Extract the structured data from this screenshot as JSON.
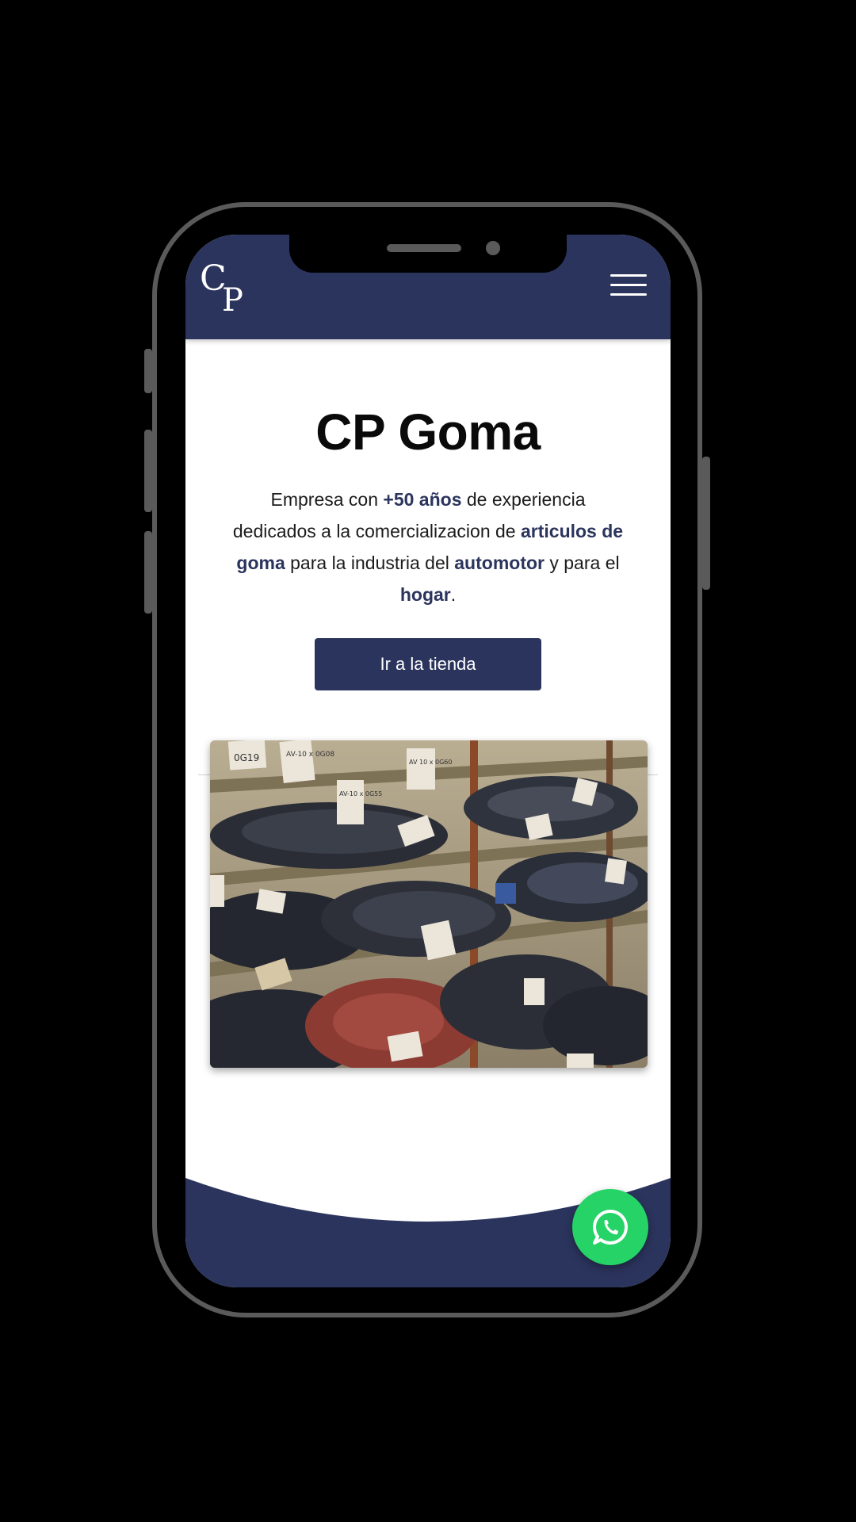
{
  "colors": {
    "brand": "#2b345d",
    "whatsapp": "#25d366",
    "background": "#000000"
  },
  "header": {
    "logo": "CP",
    "menu_icon": "hamburger-icon"
  },
  "hero": {
    "title": "CP Goma",
    "text_parts": [
      {
        "text": "Empresa con ",
        "bold": false
      },
      {
        "text": "+50 años",
        "bold": true
      },
      {
        "text": " de experiencia dedicados a la comercializacion de ",
        "bold": false
      },
      {
        "text": "articulos de goma",
        "bold": true
      },
      {
        "text": " para la industria del ",
        "bold": false
      },
      {
        "text": "automotor",
        "bold": true
      },
      {
        "text": " y para el ",
        "bold": false
      },
      {
        "text": "hogar",
        "bold": true
      },
      {
        "text": ".",
        "bold": false
      }
    ],
    "cta_label": "Ir a la tienda"
  },
  "photo": {
    "tags": [
      "0G19",
      "AV-10 x 0G08",
      "AV-10 x 0G55",
      "AV 10 x 0G60"
    ]
  },
  "floating": {
    "whatsapp_icon": "whatsapp-icon"
  }
}
